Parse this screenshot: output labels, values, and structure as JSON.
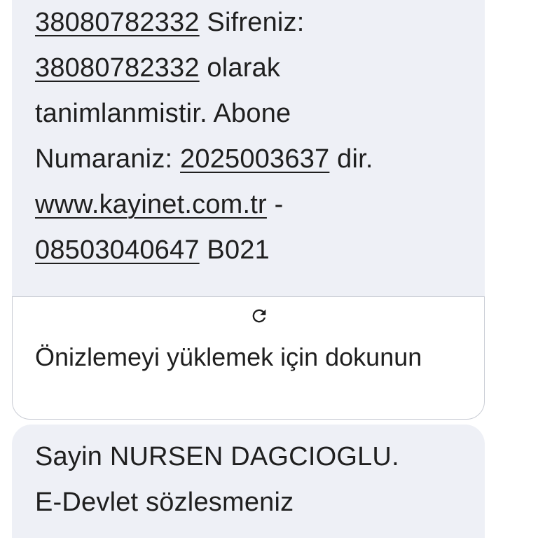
{
  "message1": {
    "lines": [
      {
        "link": "38080782332",
        "text": " Sifreniz:"
      },
      {
        "link": "38080782332",
        "text": " olarak"
      },
      {
        "text": "tanimlanmistir. Abone"
      },
      {
        "text": "Numaraniz: ",
        "link": "2025003637",
        "tail": " dir."
      },
      {
        "link": "www.kayinet.com.tr",
        "text": " -"
      },
      {
        "link": "08503040647",
        "text": " B021"
      }
    ]
  },
  "preview": {
    "icon": "refresh-icon",
    "label": "Önizlemeyi yüklemek için dokunun"
  },
  "message2": {
    "line1": "Sayin NURSEN DAGCIOGLU.",
    "line2": "E-Devlet sözlesmeniz"
  },
  "colors": {
    "bubble": "#eef0f6",
    "text": "#1f1f1f",
    "card_border": "#c9ccd4"
  }
}
